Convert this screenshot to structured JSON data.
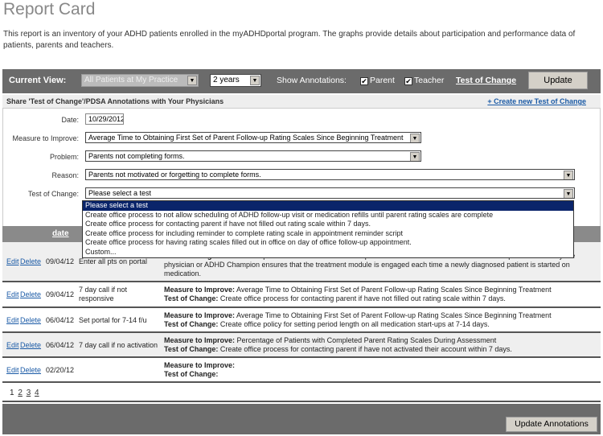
{
  "title": "Report Card",
  "intro": "This report is an inventory of your ADHD patients enrolled in the myADHDportal program. The graphs provide details about participation and performance data of patients, parents and teachers.",
  "toolbar": {
    "current_view_label": "Current View:",
    "view_value": "All Patients at My Practice",
    "period_value": "2 years",
    "show_annotations_label": "Show Annotations:",
    "parent_label": "Parent",
    "parent_checked": true,
    "teacher_label": "Teacher",
    "teacher_checked": true,
    "test_of_change_link": "Test of Change",
    "update_label": "Update",
    "check": "✔",
    "arrow": "▼"
  },
  "share": {
    "title": "Share 'Test of Change'/PDSA Annotations with Your Physicians",
    "create_link": "+ Create new Test of Change"
  },
  "form": {
    "date_label": "Date:",
    "date_value": "10/29/2012",
    "measure_label": "Measure to Improve:",
    "measure_value": "Average Time to Obtaining First Set of Parent Follow-up Rating Scales Since Beginning Treatment",
    "problem_label": "Problem:",
    "problem_value": "Parents not completing forms.",
    "reason_label": "Reason:",
    "reason_value": "Parents not motivated or forgetting to complete forms.",
    "test_label": "Test of Change:",
    "test_value": "Please select a test",
    "test_options": [
      "Please select a test",
      "Create office process to not allow scheduling of ADHD follow-up visit or medication refills until parent rating scales are complete",
      "Create office process for contacting parent if have not filled out rating scale within 7 days.",
      "Create office process for including reminder to complete rating scale in appointment reminder script",
      "Create office process for having rating scales filled out in office on day of office follow-up appointment.",
      "Custom..."
    ]
  },
  "table": {
    "date_header": "date",
    "edit_label": "Edit",
    "delete_label": "Delete",
    "measure_label": "Measure to Improve:",
    "test_label": "Test of Change:",
    "rows": [
      {
        "date": "09/04/12",
        "desc": "Enter all pts on portal",
        "measure": "",
        "test": "Create office process to enroll all new ADHD patients. Use the office flow wizard to create process whereby the physician or ADHD Champion ensures that the treatment module is engaged each time a newly diagnosed patient is started on medication."
      },
      {
        "date": "09/04/12",
        "desc": "7 day call if not responsive",
        "measure": "Average Time to Obtaining First Set of Parent Follow-up Rating Scales Since Beginning Treatment",
        "test": "Create office process for contacting parent if have not filled out rating scale within 7 days."
      },
      {
        "date": "06/04/12",
        "desc": "Set portal for 7-14 f/u",
        "measure": "Average Time to Obtaining First Set of Parent Follow-up Rating Scales Since Beginning Treatment",
        "test": "Create office policy for setting period length on all medication start-ups at 7-14 days."
      },
      {
        "date": "06/04/12",
        "desc": "7 day call if no activation",
        "measure": "Percentage of Patients with Completed Parent Rating Scales During Assessment",
        "test": "Create office process for contacting parent if have not activated their account within 7 days."
      },
      {
        "date": "02/20/12",
        "desc": "",
        "measure": "",
        "test": ""
      }
    ]
  },
  "pagination": [
    "1",
    "2",
    "3",
    "4"
  ],
  "footer": {
    "update_annotations_label": "Update Annotations"
  }
}
